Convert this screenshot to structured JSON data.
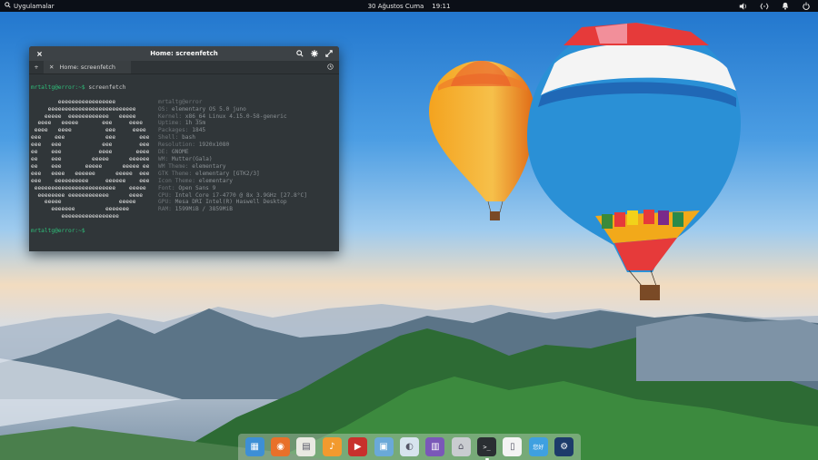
{
  "panel": {
    "apps_label": "Uygulamalar",
    "date": "30 Ağustos Cuma",
    "time": "19:11"
  },
  "terminal": {
    "title": "Home: screenfetch",
    "tab_label": "Home: screenfetch",
    "prompt": "mrtaltg@error:~$",
    "command": " screenfetch",
    "logo_lines": [
      "        eeeeeeeeeeeeeeeee",
      "     eeeeeeeeeeeeeeeeeeeeeeeeee",
      "    eeeee  eeeeeeeeeeee   eeeee",
      "  eeee   eeeee       eee     eeee",
      " eeee   eeee          eee     eeee",
      "eee    eee            eee       eee",
      "eee   eee            eee        eee",
      "ee    eee           eeee       eeee",
      "ee    eee         eeeee      eeeeee",
      "ee    eee       eeeee      eeeee ee",
      "eee   eeee   eeeeee      eeeee  eee",
      "eee    eeeeeeeeee     eeeeee    eee",
      " eeeeeeeeeeeeeeeeeeeeeeee    eeeee",
      "  eeeeeeee eeeeeeeeeeee      eeee",
      "    eeeee                 eeeee",
      "      eeeeeee         eeeeeee",
      "         eeeeeeeeeeeeeeeee"
    ],
    "info": [
      {
        "k": "mrtaltg@error",
        "v": ""
      },
      {
        "k": "OS:",
        "v": "elementary OS 5.0 juno"
      },
      {
        "k": "Kernel:",
        "v": "x86_64 Linux 4.15.0-58-generic"
      },
      {
        "k": "Uptime:",
        "v": "1h 35m"
      },
      {
        "k": "Packages:",
        "v": "1845"
      },
      {
        "k": "Shell:",
        "v": "bash"
      },
      {
        "k": "Resolution:",
        "v": "1920x1080"
      },
      {
        "k": "DE:",
        "v": "GNOME"
      },
      {
        "k": "WM:",
        "v": "Mutter(Gala)"
      },
      {
        "k": "WM Theme:",
        "v": "elementary"
      },
      {
        "k": "GTK Theme:",
        "v": "elementary [GTK2/3]"
      },
      {
        "k": "Icon Theme:",
        "v": "elementary"
      },
      {
        "k": "Font:",
        "v": "Open Sans 9"
      },
      {
        "k": "CPU:",
        "v": "Intel Core i7-4770 @ 8x 3.9GHz [27.8°C]"
      },
      {
        "k": "GPU:",
        "v": "Mesa DRI Intel(R) Haswell Desktop"
      },
      {
        "k": "RAM:",
        "v": "1599MiB / 3859MiB"
      }
    ],
    "final_prompt": "mrtaltg@error:~$"
  },
  "dock": {
    "items": [
      {
        "name": "multitasking-view-icon",
        "color": "#3d8fd6",
        "glyph": "▦"
      },
      {
        "name": "firefox-icon",
        "color": "#e8702a",
        "glyph": "◉"
      },
      {
        "name": "calendar-icon",
        "color": "#e9e9e2",
        "glyph": "▤"
      },
      {
        "name": "music-icon",
        "color": "#f29a2e",
        "glyph": "♪"
      },
      {
        "name": "videos-icon",
        "color": "#c8302c",
        "glyph": "▶"
      },
      {
        "name": "photos-icon",
        "color": "#6aa9d8",
        "glyph": "▣"
      },
      {
        "name": "settings-toggle-icon",
        "color": "#d7e4ee",
        "glyph": "◐"
      },
      {
        "name": "appcenter-icon",
        "color": "#7a58b8",
        "glyph": "▥"
      },
      {
        "name": "files-icon",
        "color": "#c9ccd0",
        "glyph": "⌂"
      },
      {
        "name": "terminal-icon",
        "color": "#2a2e32",
        "glyph": ">_"
      },
      {
        "name": "text-editor-icon",
        "color": "#f3f3f3",
        "glyph": "▯"
      },
      {
        "name": "input-method-icon",
        "color": "#3fa0e0",
        "glyph": "您好"
      },
      {
        "name": "steam-icon",
        "color": "#1d3b6a",
        "glyph": "⚙"
      }
    ]
  }
}
